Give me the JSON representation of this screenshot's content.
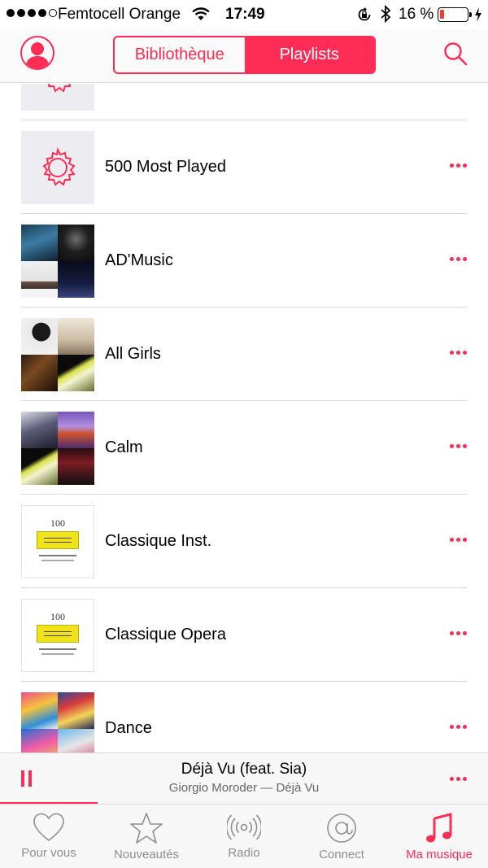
{
  "status_bar": {
    "carrier": "Femtocell Orange",
    "time": "17:49",
    "battery_percent": "16 %",
    "battery_level": 0.16
  },
  "header": {
    "segments": [
      "Bibliothèque",
      "Playlists"
    ],
    "active_segment": "Playlists"
  },
  "playlists": [
    {
      "title": "",
      "art": "gear"
    },
    {
      "title": "500 Most Played",
      "art": "gear"
    },
    {
      "title": "AD'Music",
      "art": "mosaic-admusic"
    },
    {
      "title": "All Girls",
      "art": "mosaic-allgirls"
    },
    {
      "title": "Calm",
      "art": "mosaic-calm"
    },
    {
      "title": "Classique Inst.",
      "art": "deutsche-grammophon-100"
    },
    {
      "title": "Classique Opera",
      "art": "deutsche-grammophon-100"
    },
    {
      "title": "Dance",
      "art": "mosaic-dance"
    }
  ],
  "album_art_text": {
    "dg_number": "100"
  },
  "now_playing": {
    "title": "Déjà Vu (feat. Sia)",
    "subtitle": "Giorgio Moroder — Déjà Vu",
    "progress": 0.2
  },
  "tabbar": {
    "tabs": [
      {
        "label": "Pour vous",
        "icon": "heart-icon"
      },
      {
        "label": "Nouveautés",
        "icon": "star-icon"
      },
      {
        "label": "Radio",
        "icon": "radio-icon"
      },
      {
        "label": "Connect",
        "icon": "at-icon"
      },
      {
        "label": "Ma musique",
        "icon": "music-note-icon"
      }
    ],
    "active_tab": "Ma musique"
  },
  "colors": {
    "accent": "#ff2d55",
    "inactive": "#8e8e93",
    "battery_low": "#ff3b30"
  }
}
